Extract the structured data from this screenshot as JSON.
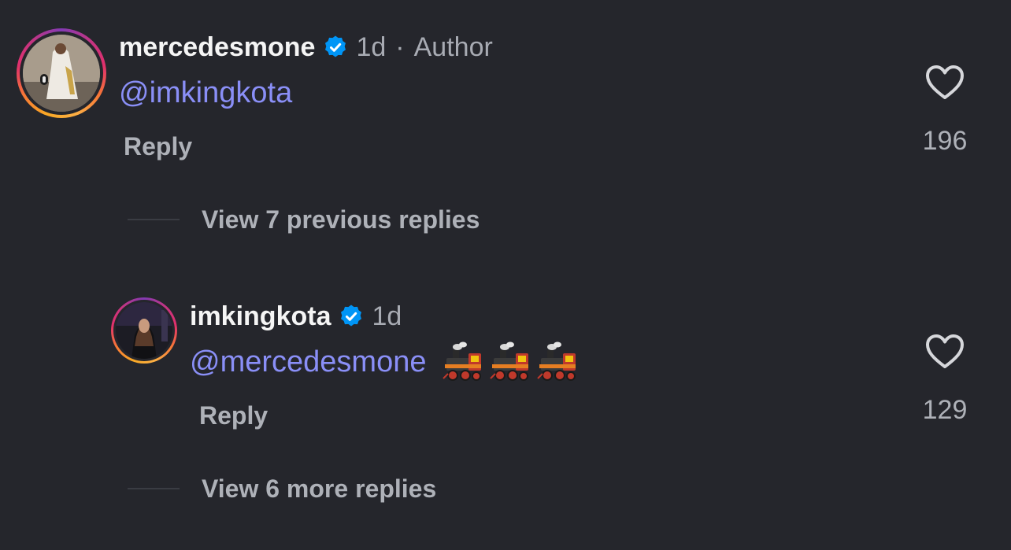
{
  "comments": [
    {
      "username": "mercedesmone",
      "time": "1d",
      "separator": "·",
      "badge": "Author",
      "mention": "@imkingkota",
      "reply_label": "Reply",
      "like_count": "196",
      "verified_icon": "verified-badge-icon",
      "like_icon": "heart-outline-icon"
    },
    {
      "username": "imkingkota",
      "time": "1d",
      "mention": "@mercedesmone",
      "emojis": [
        "steam-locomotive",
        "steam-locomotive",
        "steam-locomotive"
      ],
      "reply_label": "Reply",
      "like_count": "129",
      "verified_icon": "verified-badge-icon",
      "like_icon": "heart-outline-icon"
    }
  ],
  "threads": {
    "view_previous": "View 7 previous replies",
    "view_more": "View 6 more replies"
  },
  "colors": {
    "background": "#25262c",
    "mention": "#8a8ff7",
    "verified": "#0095f6",
    "secondary_text": "#aeb1b8"
  }
}
